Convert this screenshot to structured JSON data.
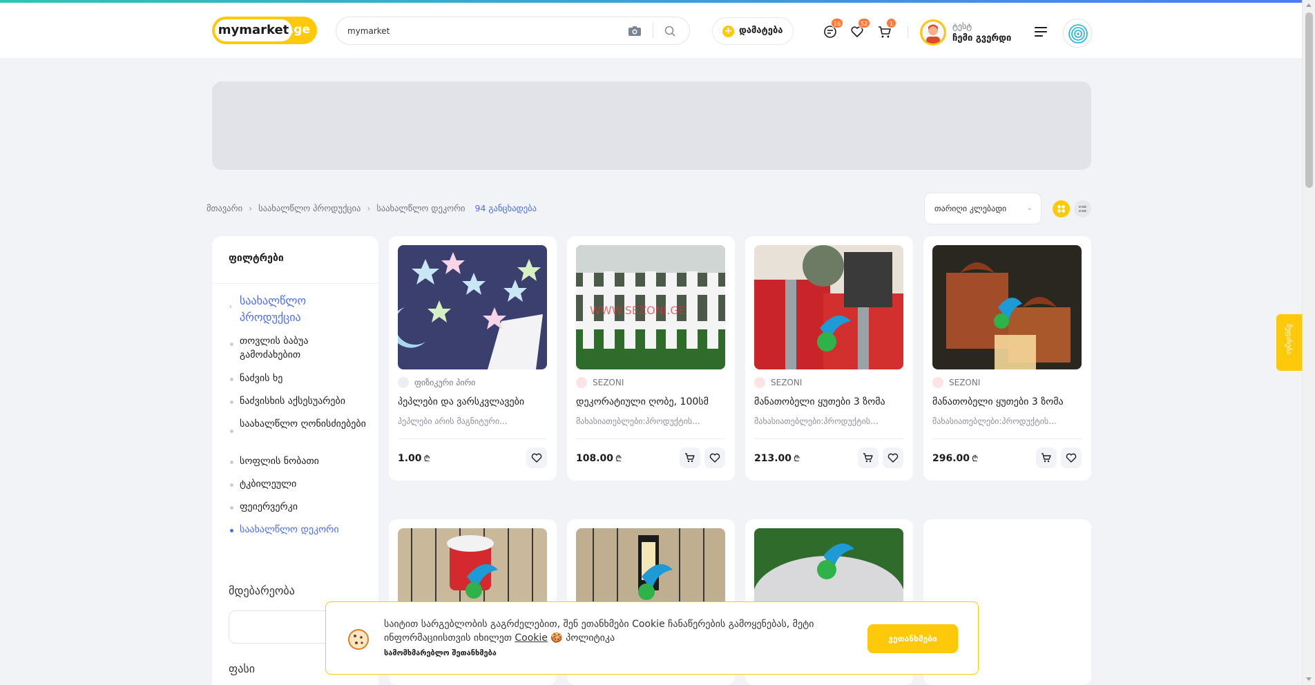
{
  "header": {
    "logo": {
      "main": "mymarket",
      "tld": ".ge"
    },
    "search": {
      "value": "mymarket"
    },
    "add_button": "დამატება",
    "badges": {
      "messages": "16",
      "favorites": "52",
      "cart": "1"
    },
    "user": {
      "name": "ტესტ",
      "link": "ჩემი გვერდი"
    }
  },
  "breadcrumbs": {
    "items": [
      "მთავარი",
      "საახალწლო პროდუქცია",
      "საახალწლო დეკორი"
    ],
    "count": "94 განცხადება"
  },
  "sort": {
    "value": "თარიღი კლებადი"
  },
  "sidebar": {
    "title": "ფილტრები",
    "category": "საახალწლო პროდუქცია",
    "items": [
      "თოვლის ბაბუა გამოძახებით",
      "ნაძვის ხე",
      "ნაძვისხის აქსესუარები",
      "საახალწლო ღონისძიებები",
      "სოფლის ნობათი",
      "ტკბილეული",
      "ფეიერვერკი",
      "საახალწლო დეკორი"
    ],
    "location_label": "მდებარეობა",
    "price_label": "ფასი"
  },
  "products": [
    {
      "seller": "ფიზიკური პირი",
      "title": "პეპლები და ვარსკვლავები",
      "desc": "პეპლები არის მაგნიტური...",
      "price": "1.00",
      "currency": "₾"
    },
    {
      "seller": "SEZONI",
      "title": "დეკორატიული ღობე, 100სმ",
      "desc": "მახასიათებლები:პროდუქტის...",
      "price": "108.00",
      "currency": "₾"
    },
    {
      "seller": "SEZONI",
      "title": "მანათობელი ყუთები 3 ზომა",
      "desc": "მახასიათებლები:პროდუქტის...",
      "price": "213.00",
      "currency": "₾"
    },
    {
      "seller": "SEZONI",
      "title": "მანათობელი ყუთები 3 ზომა",
      "desc": "მახასიათებლები:პროდუქტის...",
      "price": "296.00",
      "currency": "₾"
    }
  ],
  "cookie": {
    "text": "საიტით სარგებლობის გაგრძელებით, შენ ეთანხმები Cookie ჩანაწერების გამოყენებას, მეტი ინფორმაციისთვის იხილეთ",
    "link": "Cookie",
    "link_suffix": "🍪 პოლიტიკა",
    "policy": "სამომხმარებლო შეთანხმება",
    "button": "ვეთანხმები"
  },
  "side_tab": "შეფასება",
  "colors": {
    "accent": "#fec90b",
    "link": "#4a6cf7",
    "badge": "#fd7a3a",
    "background": "#f1f3f6"
  }
}
